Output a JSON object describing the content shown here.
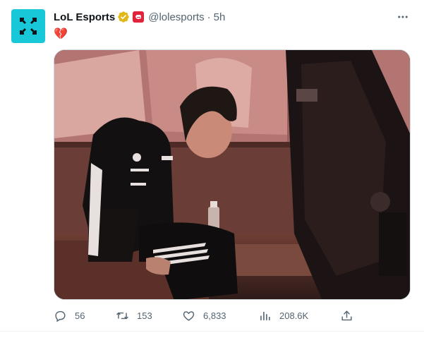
{
  "author": {
    "name": "LoL Esports",
    "handle": "@lolesports",
    "separator": "·",
    "time": "5h",
    "avatar_icon": "lol-esports-logo",
    "verified_icon": "gold-verified-badge",
    "affiliate_icon": "riot-fist-badge"
  },
  "tweet": {
    "text": "💔",
    "media_description": "photo"
  },
  "actions": {
    "replies": "56",
    "retweets": "153",
    "likes": "6,833",
    "views": "208.6K"
  },
  "colors": {
    "avatar_bg": "#18c7d8",
    "verified_gold": "#e2b719",
    "affiliate_red": "#e0243b",
    "muted_text": "#536471"
  }
}
